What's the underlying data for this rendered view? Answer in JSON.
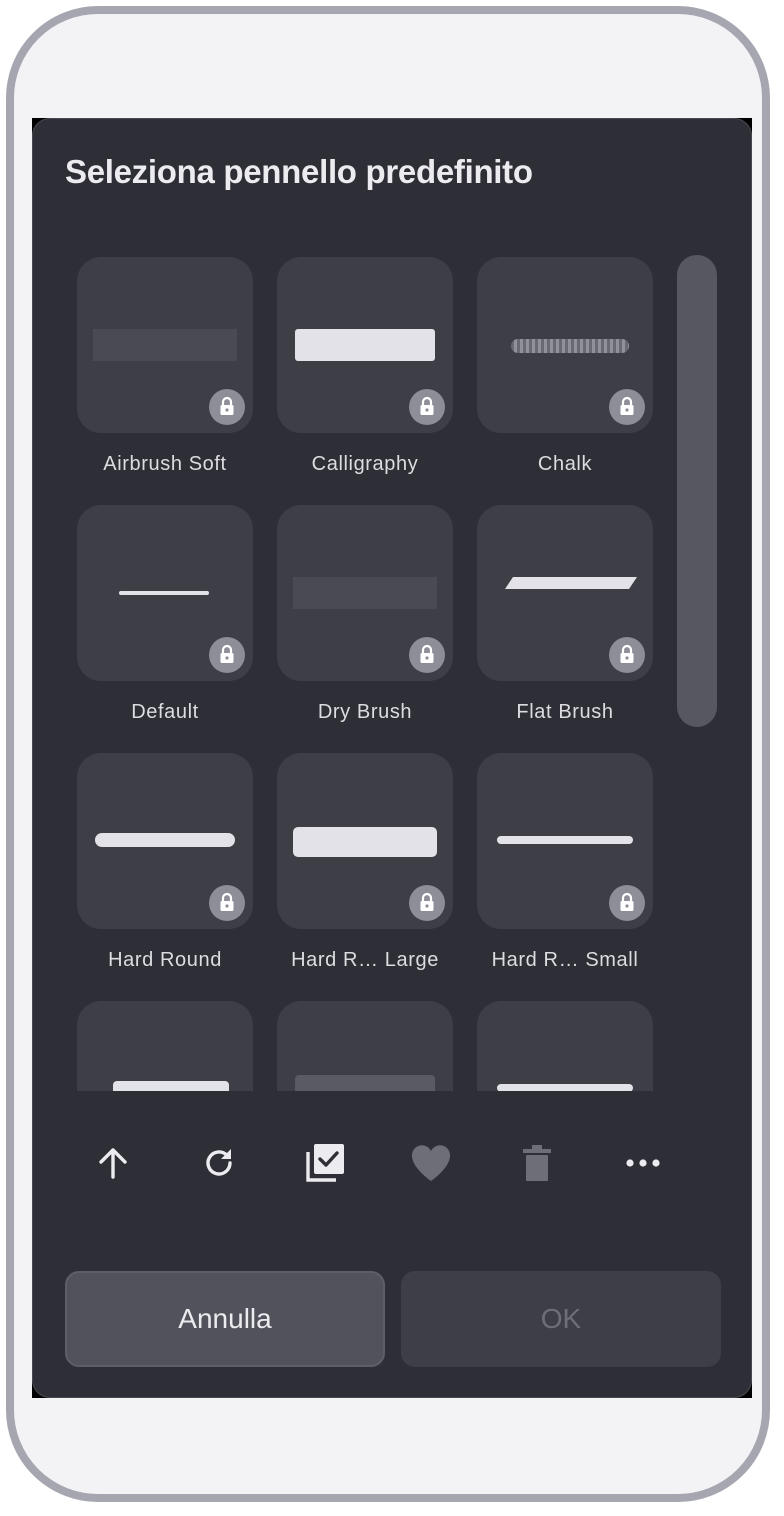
{
  "dialog": {
    "title": "Seleziona pennello predefinito",
    "cancel_label": "Annulla",
    "ok_label": "OK"
  },
  "brushes": [
    {
      "name": "Airbrush Soft",
      "icon": "airbrush-soft-stroke",
      "locked": true
    },
    {
      "name": "Calligraphy",
      "icon": "calligraphy-stroke",
      "locked": true
    },
    {
      "name": "Chalk",
      "icon": "chalk-stroke",
      "locked": true
    },
    {
      "name": "Default",
      "icon": "default-stroke",
      "locked": true
    },
    {
      "name": "Dry Brush",
      "icon": "dry-brush-stroke",
      "locked": true
    },
    {
      "name": "Flat Brush",
      "icon": "flat-brush-stroke",
      "locked": true
    },
    {
      "name": "Hard Round",
      "icon": "hard-round-stroke",
      "locked": true
    },
    {
      "name": "Hard R… Large",
      "icon": "hard-round-large-stroke",
      "locked": true
    },
    {
      "name": "Hard R… Small",
      "icon": "hard-round-small-stroke",
      "locked": true
    }
  ],
  "toolbar": {
    "icons": [
      "arrow-up-icon",
      "refresh-icon",
      "select-all-icon",
      "heart-icon",
      "trash-icon",
      "more-icon"
    ]
  },
  "colors": {
    "dialog_bg": "#2e2e36",
    "tile_bg": "#3e3e47",
    "stroke": "#e2e2e8",
    "lock_badge": "#8e8e98",
    "disabled": "#6e6e78"
  }
}
